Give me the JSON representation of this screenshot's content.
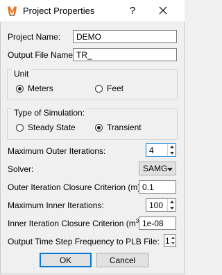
{
  "window": {
    "title": "Project Properties",
    "help": "?"
  },
  "fields": {
    "project_name_label": "Project Name:",
    "project_name_value": "DEMO",
    "output_file_label": "Output File Name:",
    "output_file_value": "TR_"
  },
  "unit": {
    "title": "Unit",
    "options": [
      "Meters",
      "Feet"
    ],
    "selected": "Meters"
  },
  "simulation": {
    "title": "Type of Simulation:",
    "options": [
      "Steady State",
      "Transient"
    ],
    "selected": "Transient"
  },
  "settings": {
    "max_outer_label": "Maximum Outer Iterations:",
    "max_outer_value": "4",
    "solver_label": "Solver:",
    "solver_value": "SAMG",
    "outer_crit_label": "Outer Iteration Closure Criterion (m):",
    "outer_crit_value": "0.1",
    "max_inner_label": "Maximum Inner Iterations:",
    "max_inner_value": "100",
    "inner_crit_label_prefix": "Inner Iteration Closure Criterion (m",
    "inner_crit_label_sup": "3",
    "inner_crit_label_suffix": "):",
    "inner_crit_value": "1e-08",
    "plb_freq_label": "Output Time Step Frequency to PLB File:",
    "plb_freq_value": "1"
  },
  "buttons": {
    "ok": "OK",
    "cancel": "Cancel"
  },
  "colors": {
    "focus": "#0078d7",
    "icon_orange": "#e8731c",
    "icon_grey": "#8a8a8a"
  }
}
